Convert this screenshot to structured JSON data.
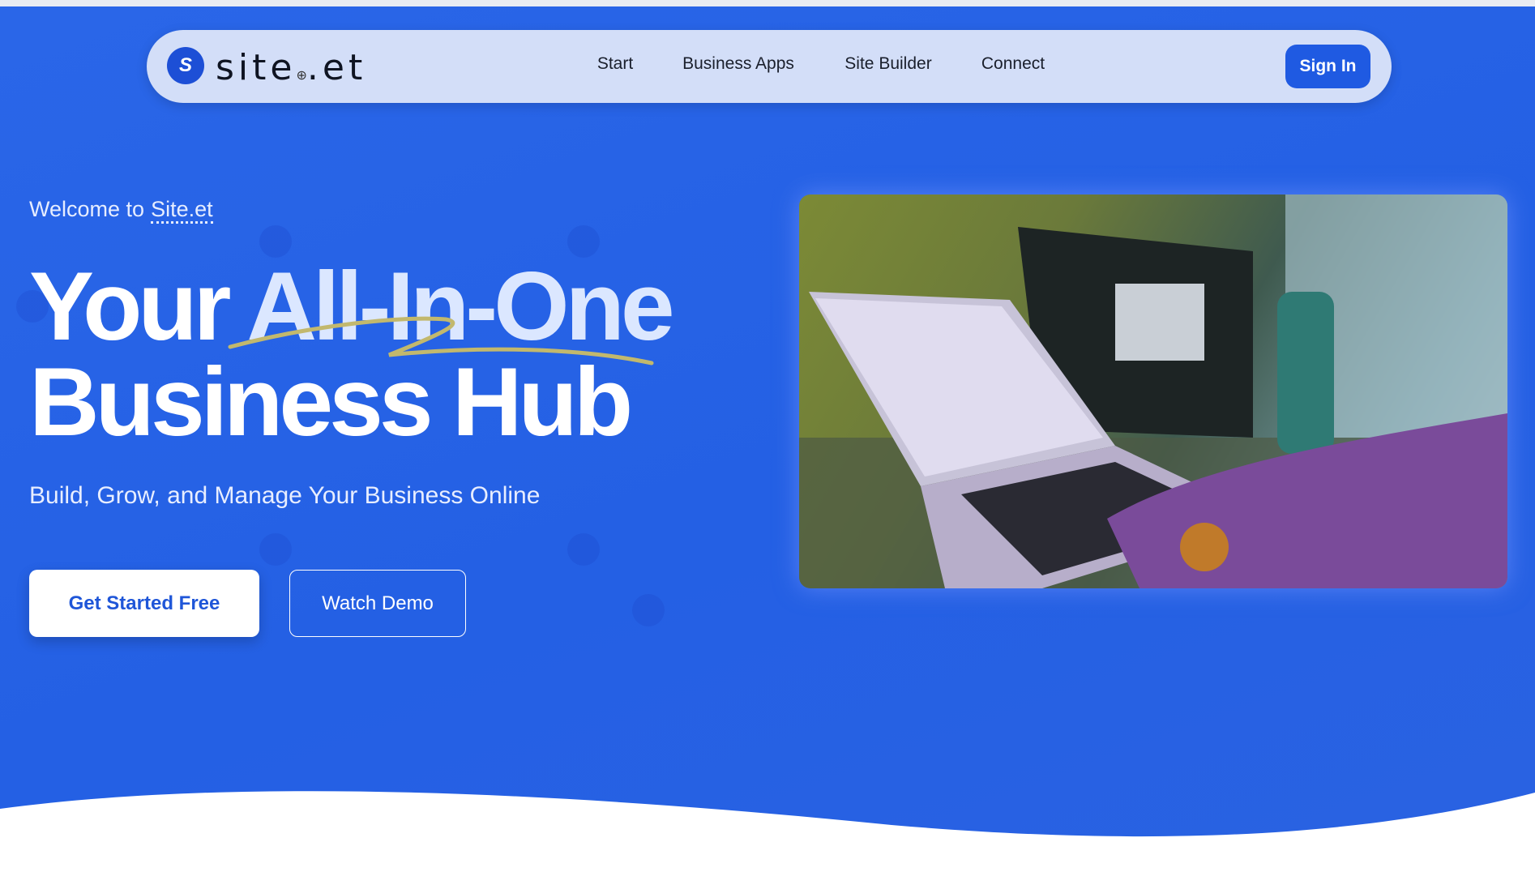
{
  "brand": {
    "logo_text": "site",
    "logo_suffix": ".et",
    "logo_mark": "S",
    "accent": "#1f5ae2",
    "background": "#2563e6"
  },
  "nav": {
    "items": [
      {
        "label": "Start"
      },
      {
        "label": "Business Apps"
      },
      {
        "label": "Site Builder"
      },
      {
        "label": "Connect"
      }
    ],
    "sign_in": "Sign In"
  },
  "hero": {
    "welcome": "Welcome to",
    "welcome_brand": "Site.et",
    "title_part1": "Your",
    "title_highlight": "All-In-One",
    "title_line2": "Business Hub",
    "subtitle": "Build, Grow, and Manage Your Business Online",
    "cta_primary": "Get Started Free",
    "cta_secondary": "Watch Demo",
    "image_alt": "laptop-on-desk-photo"
  }
}
